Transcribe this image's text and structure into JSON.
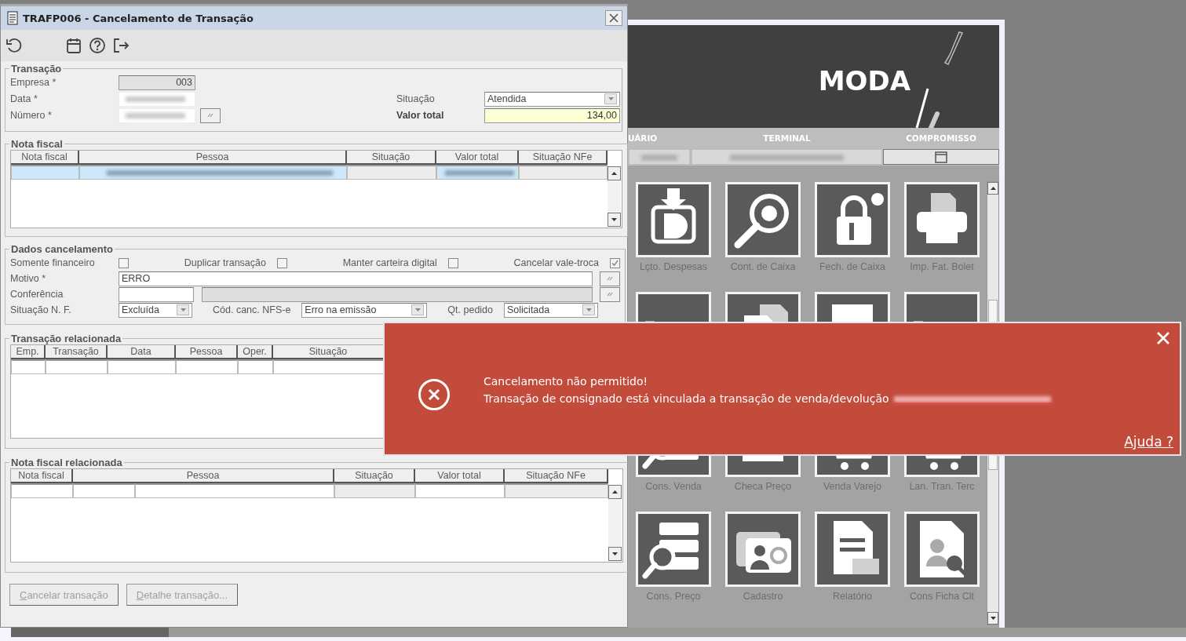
{
  "window": {
    "title": "TRAFP006 - Cancelamento de Transação"
  },
  "transacao": {
    "legend": "Transação",
    "fields": [
      {
        "label": "Empresa *",
        "value": "003",
        "kind": "readonly"
      },
      {
        "label": "Data *",
        "kind": "redacted"
      },
      {
        "label": "Número *",
        "kind": "redacted_lookup"
      }
    ],
    "situacao": {
      "label": "Situação",
      "value": "Atendida"
    },
    "valor_total": {
      "label": "Valor total",
      "value": "134,00"
    }
  },
  "nota_fiscal": {
    "legend": "Nota fiscal",
    "columns": [
      "Nota fiscal",
      "Pessoa",
      "Situação",
      "Valor total",
      "Situação NFe"
    ],
    "rows": [
      {
        "selected": true,
        "redacted": true
      }
    ]
  },
  "dados_cancelamento": {
    "legend": "Dados cancelamento",
    "checkboxes": [
      {
        "label": "Somente financeiro",
        "checked": false
      },
      {
        "label": "Duplicar transação",
        "checked": false
      },
      {
        "label": "Manter carteira digital",
        "checked": false
      },
      {
        "label": "Cancelar vale-troca",
        "checked": true
      }
    ],
    "motivo": {
      "label": "Motivo *",
      "value": "ERRO"
    },
    "conferencia": {
      "label": "Conferência"
    },
    "selects": [
      {
        "label": "Situação N. F.",
        "value": "Excluída"
      },
      {
        "label": "Cód. canc. NFS-e",
        "value": "Erro na emissão"
      },
      {
        "label": "Qt. pedido",
        "value": "Solicitada"
      }
    ]
  },
  "transacao_relacionada": {
    "legend": "Transação relacionada",
    "columns": [
      "Emp.",
      "Transação",
      "Data",
      "Pessoa",
      "Oper.",
      "Situação"
    ]
  },
  "nota_fiscal_relacionada": {
    "legend": "Nota fiscal relacionada",
    "columns": [
      "Nota fiscal",
      "Pessoa",
      "Situação",
      "Valor total",
      "Situação NFe"
    ]
  },
  "buttons": [
    {
      "label": "Cancelar transação",
      "disabled": true
    },
    {
      "label": "Detalhe transação...",
      "disabled": true
    }
  ],
  "background_app": {
    "brand": "MODA",
    "headers": [
      "UÁRIO",
      "TERMINAL",
      "COMPROMISSO"
    ],
    "tile_rows": [
      {
        "kind": "labeled",
        "labels": [
          "Lçto. Despesas",
          "Cont. de Caixa",
          "Fech. de Caixa",
          "Imp. Fat. Bolet"
        ]
      },
      {
        "kind": "covered"
      },
      {
        "kind": "labeled",
        "labels": [
          "Cons. Venda",
          "Checa Preço",
          "Venda Varejo",
          "Lan. Tran. Terc"
        ]
      },
      {
        "kind": "labeled",
        "labels": [
          "Cons. Preço",
          "Cadastro",
          "Relatório",
          "Cons Ficha Clt"
        ]
      }
    ]
  },
  "toast": {
    "title": "Cancelamento não permitido!",
    "message": "Transação de consignado está vinculada a transação de venda/devolução",
    "link": "Ajuda ?"
  }
}
